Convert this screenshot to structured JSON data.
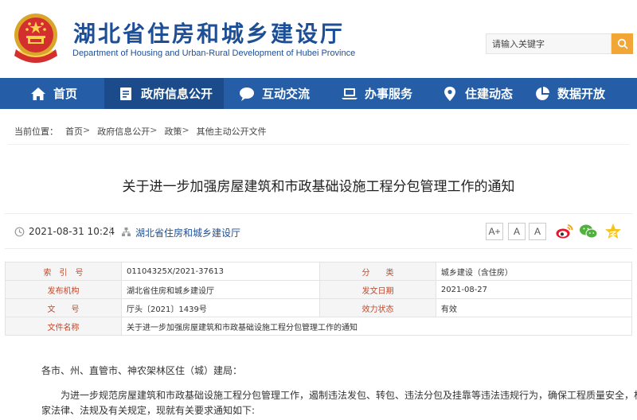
{
  "header": {
    "title": "湖北省住房和城乡建设厅",
    "subtitle": "Department of Housing and Urban-Rural Development of Hubei Province",
    "search_placeholder": "请输入关键字",
    "emblem_icon": "national-emblem-icon",
    "search_icon": "search-icon"
  },
  "nav": {
    "items": [
      {
        "label": "首页",
        "icon": "home-icon"
      },
      {
        "label": "政府信息公开",
        "icon": "document-icon"
      },
      {
        "label": "互动交流",
        "icon": "chat-bubble-icon"
      },
      {
        "label": "办事服务",
        "icon": "laptop-icon"
      },
      {
        "label": "住建动态",
        "icon": "location-pin-icon"
      },
      {
        "label": "数据开放",
        "icon": "pie-chart-icon"
      }
    ]
  },
  "breadcrumb": {
    "prefix": "当前位置：",
    "items": [
      "首页",
      "政府信息公开",
      "政策",
      "其他主动公开文件"
    ],
    "separator": ">"
  },
  "article": {
    "title": "关于进一步加强房屋建筑和市政基础设施工程分包管理工作的通知",
    "datetime": "2021-08-31 10:24",
    "publisher": "湖北省住房和城乡建设厅",
    "font_buttons": [
      "A+",
      "A",
      "A"
    ],
    "share_icons": [
      "weibo-icon",
      "wechat-icon",
      "qzone-star-icon"
    ]
  },
  "info": {
    "index_label": "索　引　号",
    "index_value": "01104325X/2021-37613",
    "category_label": "分　　类",
    "category_value": "城乡建设（含住房）",
    "issuer_label": "发布机构",
    "issuer_value": "湖北省住房和城乡建设厅",
    "date_label": "发文日期",
    "date_value": "2021-08-27",
    "docno_label": "文　　号",
    "docno_value": "厅头〔2021〕1439号",
    "status_label": "效力状态",
    "status_value": "有效",
    "name_label": "文件名称",
    "name_value": "关于进一步加强房屋建筑和市政基础设施工程分包管理工作的通知"
  },
  "body": {
    "salutation": "各市、州、直管市、神农架林区住（城）建局：",
    "para1_line1": "为进一步规范房屋建筑和市政基础设施工程分包管理工作，遏制违法发包、转包、违法分包及挂靠等违法违规行为，确保工程质量安全，根据国",
    "para1_line2": "家法律、法规及有关规定，现就有关要求通知如下:"
  },
  "colors": {
    "brand_blue": "#1e4f96",
    "nav_blue": "#255ea6",
    "nav_active": "#1b4b8a",
    "search_orange": "#f1a635",
    "label_red": "#c04a2c"
  }
}
